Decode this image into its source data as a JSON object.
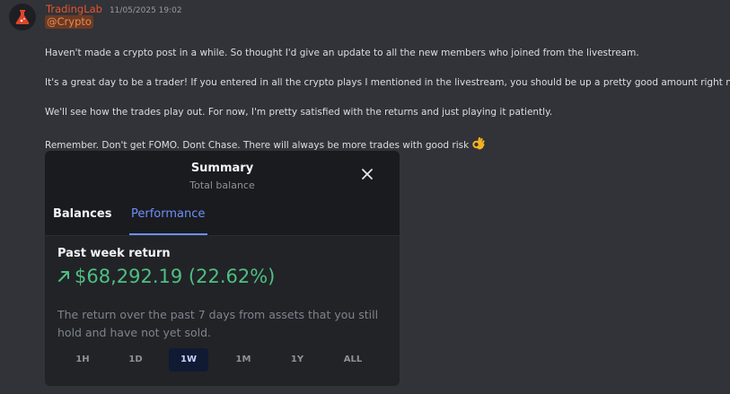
{
  "message": {
    "username": "TradingLab",
    "timestamp": "11/05/2025 19:02",
    "mention": "@Crypto",
    "lines": [
      "Haven't made a crypto post in a while. So thought I'd give an update to all the new members who joined from the livestream.",
      "It's a great day to be a trader! If you entered in all the crypto plays I mentioned in the livestream, you should be up a pretty good amount right now!",
      "We'll see how the trades play out. For now, I'm pretty satisfied with the returns and just playing it patiently.",
      "Remember. Don't get FOMO. Dont Chase. There will always be more trades with good risk"
    ],
    "emoji_icon": "ok-hand-icon"
  },
  "summary": {
    "title": "Summary",
    "subtitle": "Total balance",
    "tabs": [
      "Balances",
      "Performance"
    ],
    "active_tab": "Performance",
    "heading": "Past week return",
    "return_value": "$68,292.19 (22.62%)",
    "description": "The return over the past 7 days from assets that you still hold and have not yet sold.",
    "ranges": [
      "1H",
      "1D",
      "1W",
      "1M",
      "1Y",
      "ALL"
    ],
    "active_range": "1W",
    "accent_color": "#6e8ffa",
    "positive_color": "#4fbf82"
  }
}
